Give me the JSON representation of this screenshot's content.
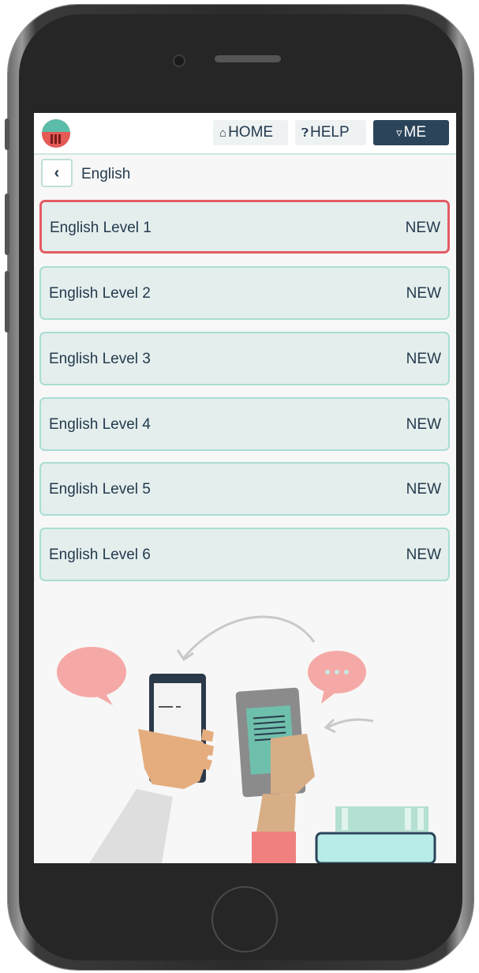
{
  "topbar": {
    "home_label": "HOME",
    "help_label": "HELP",
    "me_label": "ME"
  },
  "breadcrumb": {
    "title": "English"
  },
  "levels": [
    {
      "name": "English Level 1",
      "badge": "NEW",
      "selected": true
    },
    {
      "name": "English Level 2",
      "badge": "NEW",
      "selected": false
    },
    {
      "name": "English Level 3",
      "badge": "NEW",
      "selected": false
    },
    {
      "name": "English Level 4",
      "badge": "NEW",
      "selected": false
    },
    {
      "name": "English Level 5",
      "badge": "NEW",
      "selected": false
    },
    {
      "name": "English Level 6",
      "badge": "NEW",
      "selected": false
    }
  ],
  "icons": {
    "home": "home-icon",
    "help": "help-icon",
    "me": "user-icon",
    "back": "chevron-left-icon"
  },
  "colors": {
    "accent": "#a9ddd2",
    "selected_border": "#e45c63",
    "nav_dark": "#2b4459",
    "text": "#243a4d"
  }
}
